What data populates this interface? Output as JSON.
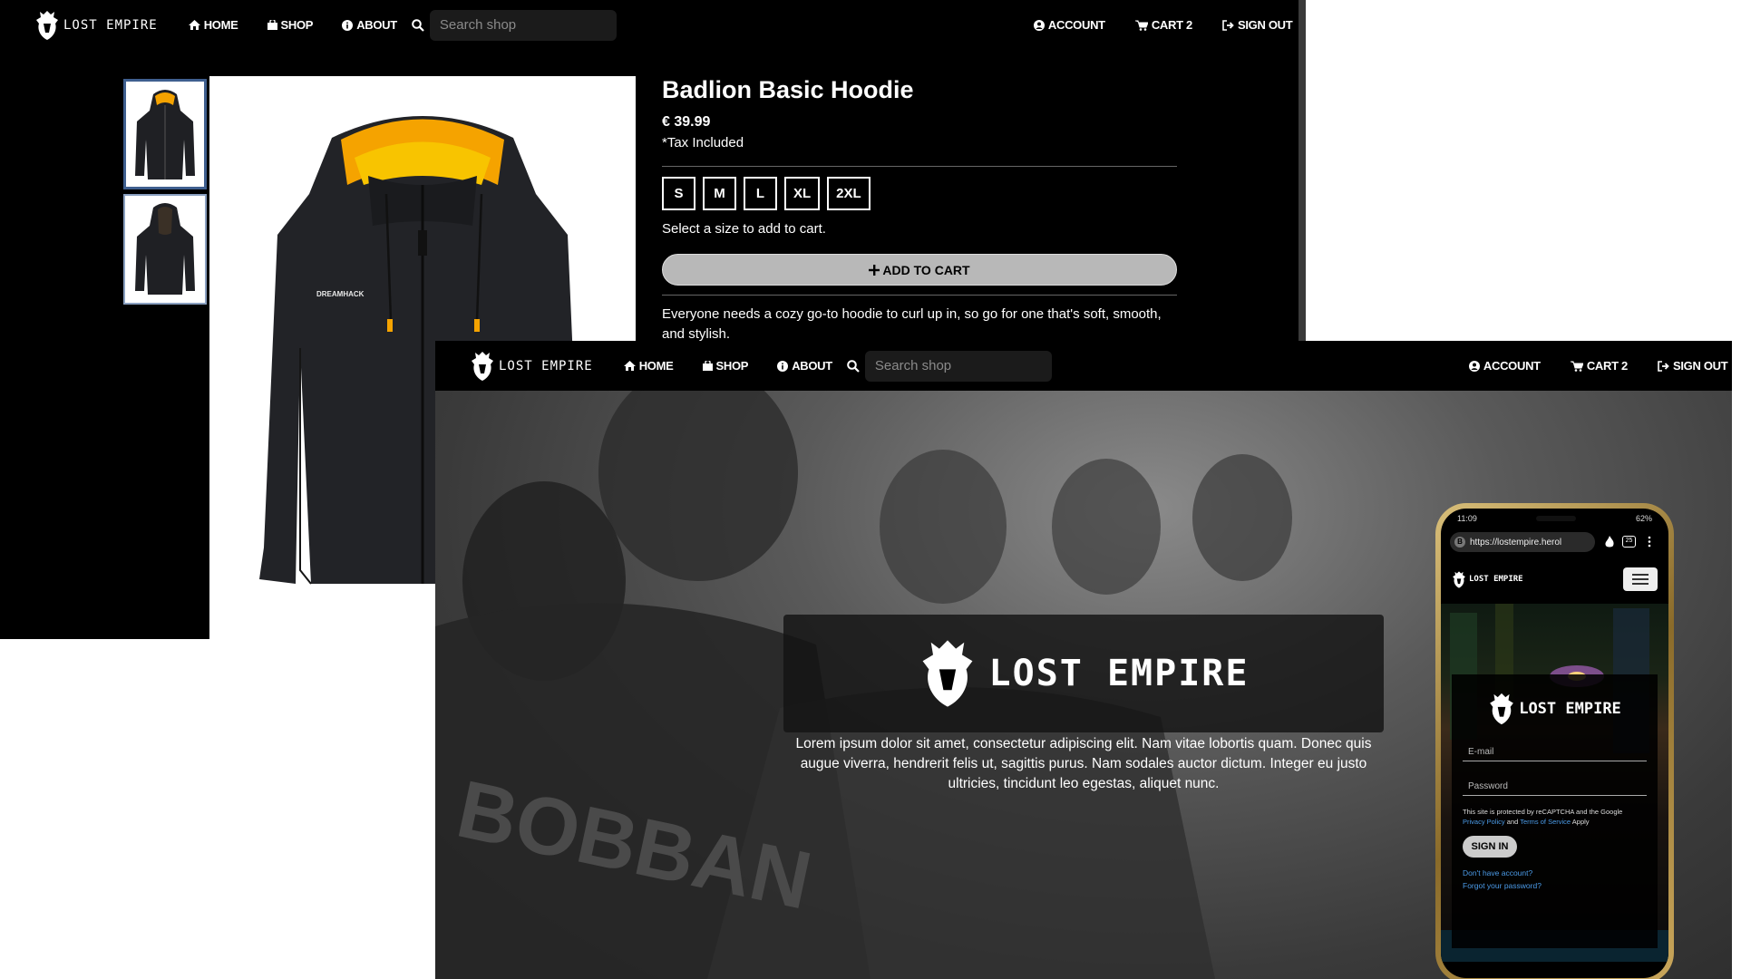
{
  "nav": {
    "logo_text": "LOST EMPIRE",
    "home": "HOME",
    "shop": "SHOP",
    "about": "ABOUT",
    "search_placeholder": "Search shop",
    "account": "ACCOUNT",
    "cart": "CART 2",
    "sign_out": "SIGN OUT"
  },
  "product": {
    "title": "Badlion Basic Hoodie",
    "price": "€ 39.99",
    "tax_note": "*Tax Included",
    "sizes": [
      "S",
      "M",
      "L",
      "XL",
      "2XL"
    ],
    "size_hint": "Select a size to add to cart.",
    "add_to_cart": "ADD TO CART",
    "description": "Everyone needs a cozy go-to hoodie to curl up in, so go for one that's soft, smooth, and stylish.",
    "hoodie_brand_print": "DREAMHACK"
  },
  "home": {
    "hero_title": "LOST EMPIRE",
    "hero_text": "Lorem ipsum dolor sit amet, consectetur adipiscing elit. Nam vitae lobortis quam. Donec quis augue viverra, hendrerit felis ut, sagittis purus. Nam sodales auctor dictum. Integer eu justo ultricies, tincidunt leo egestas, aliquet nunc.",
    "background_jersey_text": "BOBBAN"
  },
  "phone": {
    "time": "11:09",
    "battery": "62%",
    "url": "https://lostempire.herol",
    "tab_count": "25",
    "logo_text": "LOST EMPIRE",
    "card_title": "LOST EMPIRE",
    "email_placeholder": "E-mail",
    "password_placeholder": "Password",
    "legal_prefix": "This site is protected by reCAPTCHA and the Google",
    "privacy": "Privacy Policy",
    "and": "and",
    "terms": "Terms of Service",
    "apply": "Apply",
    "sign_in": "SIGN IN",
    "no_account": "Don't have account?",
    "forgot": "Forgot your password?"
  },
  "colors": {
    "nav_bg": "#000000",
    "accent_link": "#4b9be8",
    "hoodie_lining": "#f5a300"
  }
}
